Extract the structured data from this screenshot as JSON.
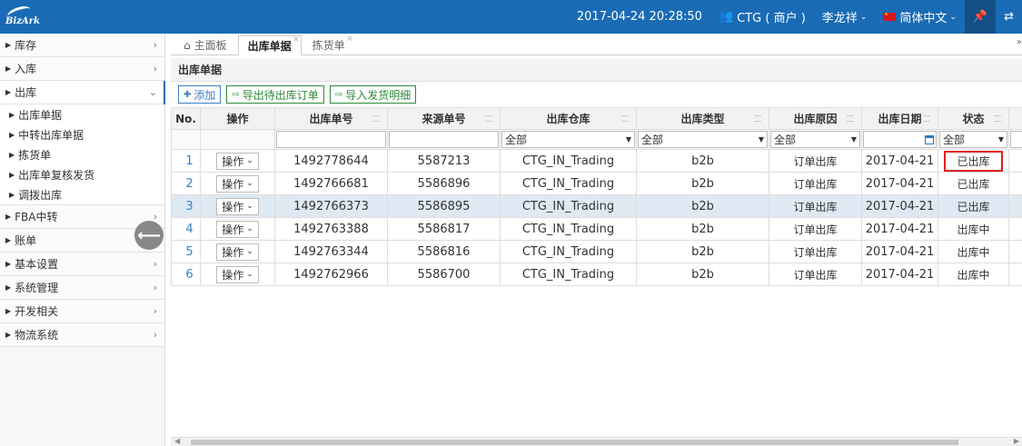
{
  "header": {
    "logo_text": "BizArk",
    "datetime": "2017-04-24 20:28:50",
    "account": "CTG ( 商户 )",
    "user": "李龙祥",
    "language": "简体中文",
    "pin_icon": "pin-icon",
    "switch_icon": "swap-icon"
  },
  "sidebar": {
    "items": [
      {
        "label": "库存"
      },
      {
        "label": "入库"
      },
      {
        "label": "出库"
      },
      {
        "label": "FBA中转"
      },
      {
        "label": "账单"
      },
      {
        "label": "基本设置"
      },
      {
        "label": "系统管理"
      },
      {
        "label": "开发相关"
      },
      {
        "label": "物流系统"
      }
    ],
    "outbound_sub": [
      {
        "label": "出库单据"
      },
      {
        "label": "中转出库单据"
      },
      {
        "label": "拣货单"
      },
      {
        "label": "出库单复核发货"
      },
      {
        "label": "调拨出库"
      }
    ]
  },
  "tabs": [
    {
      "label": "主面板"
    },
    {
      "label": "出库单据"
    },
    {
      "label": "拣货单"
    }
  ],
  "section_title": "出库单据",
  "toolbar": {
    "add": "添加",
    "export": "导出待出库订单",
    "import": "导入发货明细"
  },
  "table": {
    "headers": [
      "No.",
      "操作",
      "出库单号",
      "来源单号",
      "出库仓库",
      "出库类型",
      "出库原因",
      "出库日期",
      "状态"
    ],
    "filter_all": "全部",
    "op_label": "操作",
    "rows": [
      {
        "no": "1",
        "order": "1492778644",
        "source": "5587213",
        "warehouse": "CTG_IN_Trading",
        "type": "b2b",
        "reason": "订单出库",
        "date": "2017-04-21",
        "status": "已出库"
      },
      {
        "no": "2",
        "order": "1492766681",
        "source": "5586896",
        "warehouse": "CTG_IN_Trading",
        "type": "b2b",
        "reason": "订单出库",
        "date": "2017-04-21",
        "status": "已出库"
      },
      {
        "no": "3",
        "order": "1492766373",
        "source": "5586895",
        "warehouse": "CTG_IN_Trading",
        "type": "b2b",
        "reason": "订单出库",
        "date": "2017-04-21",
        "status": "已出库"
      },
      {
        "no": "4",
        "order": "1492763388",
        "source": "5586817",
        "warehouse": "CTG_IN_Trading",
        "type": "b2b",
        "reason": "订单出库",
        "date": "2017-04-21",
        "status": "出库中"
      },
      {
        "no": "5",
        "order": "1492763344",
        "source": "5586816",
        "warehouse": "CTG_IN_Trading",
        "type": "b2b",
        "reason": "订单出库",
        "date": "2017-04-21",
        "status": "出库中"
      },
      {
        "no": "6",
        "order": "1492762966",
        "source": "5586700",
        "warehouse": "CTG_IN_Trading",
        "type": "b2b",
        "reason": "订单出库",
        "date": "2017-04-21",
        "status": "出库中"
      }
    ]
  }
}
